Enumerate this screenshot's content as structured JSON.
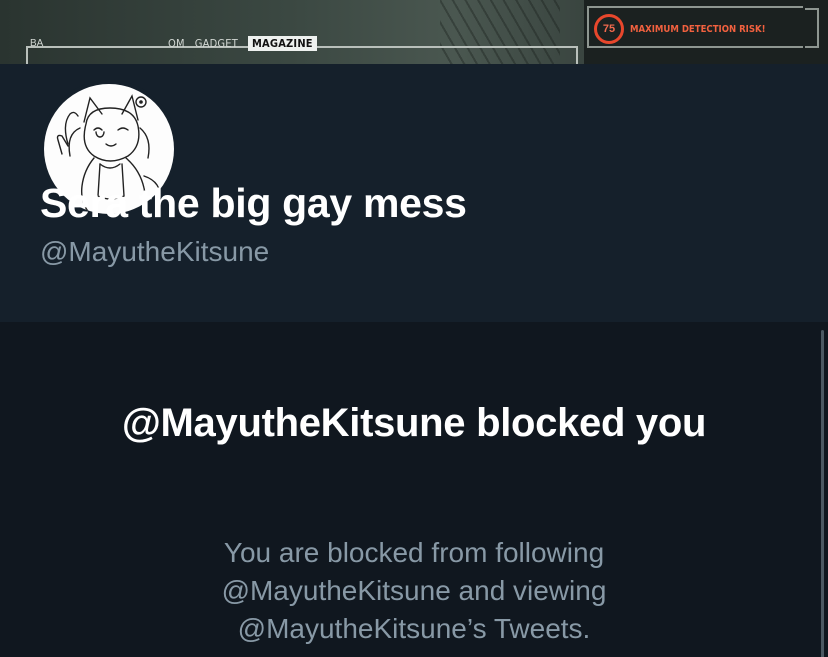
{
  "banner": {
    "left_tab": "BA",
    "tabs": [
      "OM",
      "GADGET",
      "MAGAZINE"
    ],
    "detection_value": "75",
    "detection_text": "MAXIMUM DETECTION RISK!"
  },
  "profile": {
    "display_name": "Sera the big gay mess",
    "handle": "@MayutheKitsune",
    "avatar_icon": "kitsune-girl-sketch-avatar"
  },
  "blocked": {
    "title": "@MayutheKitsune blocked you",
    "description": "You are blocked from following @MayutheKitsune and viewing @MayutheKitsune’s Tweets."
  },
  "colors": {
    "background": "#15202b",
    "blocked_background": "#10171f",
    "secondary_text": "#8899a6",
    "detection_accent": "#e8472c"
  }
}
